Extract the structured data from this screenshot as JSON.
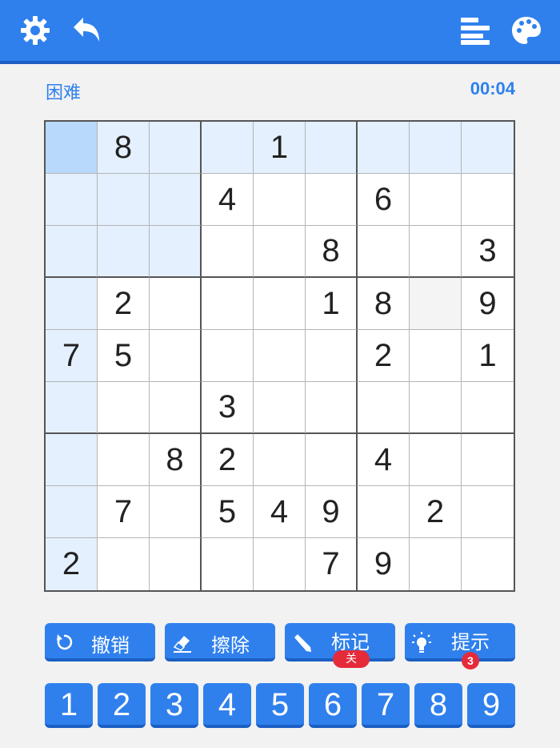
{
  "header": {
    "icons": [
      "gear-icon",
      "undo-arrow-icon",
      "stats-icon",
      "palette-icon"
    ]
  },
  "status": {
    "difficulty": "困难",
    "timer": "00:04"
  },
  "board": {
    "values": [
      [
        "",
        "8",
        "",
        "",
        "1",
        "",
        "",
        "",
        ""
      ],
      [
        "",
        "",
        "",
        "4",
        "",
        "",
        "6",
        "",
        ""
      ],
      [
        "",
        "",
        "",
        "",
        "",
        "8",
        "",
        "",
        "3"
      ],
      [
        "",
        "2",
        "",
        "",
        "",
        "1",
        "8",
        "",
        "9"
      ],
      [
        "7",
        "5",
        "",
        "",
        "",
        "",
        "2",
        "",
        "1"
      ],
      [
        "",
        "",
        "",
        "3",
        "",
        "",
        "",
        "",
        ""
      ],
      [
        "",
        "",
        "8",
        "2",
        "",
        "",
        "4",
        "",
        ""
      ],
      [
        "",
        "7",
        "",
        "5",
        "4",
        "9",
        "",
        "2",
        ""
      ],
      [
        "2",
        "",
        "",
        "",
        "",
        "7",
        "9",
        "",
        ""
      ]
    ],
    "selected_cell": [
      0,
      0
    ],
    "colors": {
      "selected": "#b8d9fb",
      "highlight": "#e4f0fd",
      "accent": "#2f80ed"
    }
  },
  "actions": {
    "undo": {
      "label": "撤销",
      "icon": "refresh-icon"
    },
    "erase": {
      "label": "擦除",
      "icon": "eraser-icon"
    },
    "notes": {
      "label": "标记",
      "badge": "关",
      "icon": "pencil-icon"
    },
    "hint": {
      "label": "提示",
      "badge": "3",
      "icon": "lightbulb-icon"
    }
  },
  "numpad": [
    "1",
    "2",
    "3",
    "4",
    "5",
    "6",
    "7",
    "8",
    "9"
  ]
}
